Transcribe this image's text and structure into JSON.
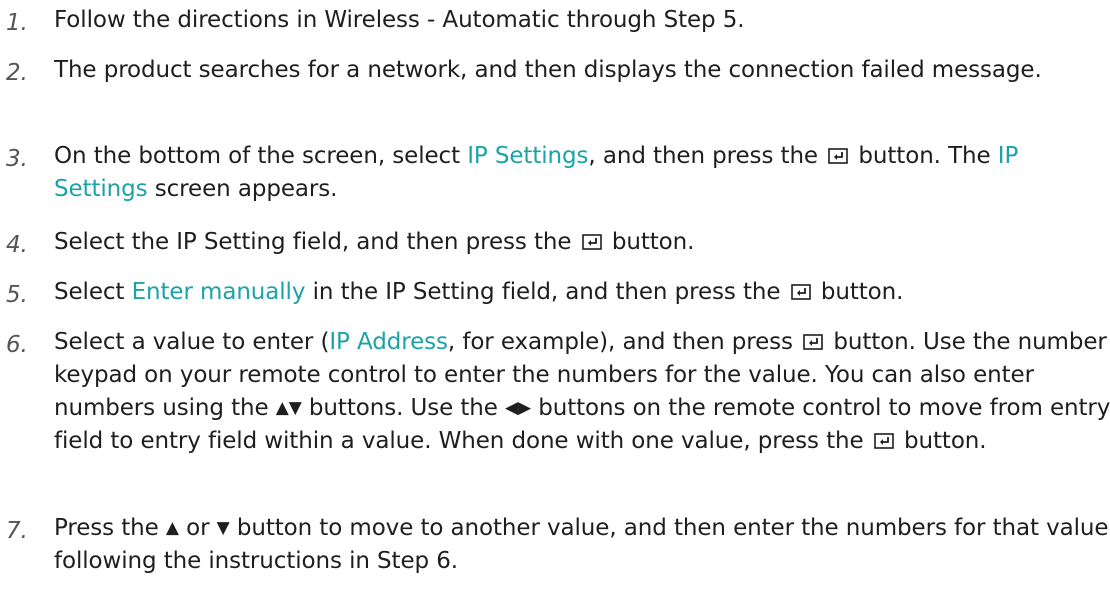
{
  "steps": [
    {
      "num": "1.",
      "parts": [
        "Follow the directions in Wireless - Automatic through Step 5."
      ]
    },
    {
      "num": "2.",
      "parts": [
        "The product searches for a network, and then displays the connection failed message."
      ]
    },
    {
      "num": "3.",
      "parts": [
        "On the bottom of the screen, select ",
        "IP Settings",
        ", and then press the ",
        " button. The ",
        "IP Settings",
        " screen appears."
      ]
    },
    {
      "num": "4.",
      "parts": [
        "Select the IP Setting field, and then press the ",
        " button."
      ]
    },
    {
      "num": "5.",
      "parts": [
        "Select ",
        "Enter manually",
        " in the IP Setting field, and then press the ",
        " button."
      ]
    },
    {
      "num": "6.",
      "parts": [
        "Select a value to enter (",
        "IP Address",
        ", for example), and then press ",
        " button. Use the number keypad on your remote control to enter the numbers for the value. You can also enter numbers using the ",
        "▲▼",
        " buttons. Use the ",
        "◀▶",
        " buttons on the remote control to move from entry field to entry field within a value. When done with one value, press the ",
        " button."
      ]
    },
    {
      "num": "7.",
      "parts": [
        "Press the ",
        "▲",
        " or ",
        "▼",
        " button to move to another value, and then enter the numbers for that value following the instructions in Step 6."
      ]
    }
  ],
  "icons": {
    "enter": "enter-button-icon"
  },
  "colors": {
    "highlight": "#1ba3a8",
    "text": "#1e1e1e",
    "number": "#555555"
  }
}
